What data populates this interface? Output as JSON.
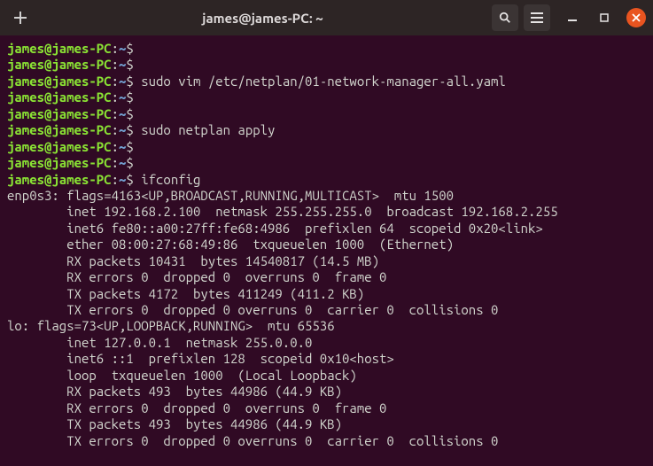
{
  "titlebar": {
    "title": "james@james-PC: ~"
  },
  "prompt": {
    "userhost": "james@james-PC",
    "colon": ":",
    "path": "~",
    "dollar": "$"
  },
  "lines": [
    {
      "type": "prompt",
      "cmd": ""
    },
    {
      "type": "prompt",
      "cmd": ""
    },
    {
      "type": "prompt",
      "cmd": "sudo vim /etc/netplan/01-network-manager-all.yaml"
    },
    {
      "type": "prompt",
      "cmd": ""
    },
    {
      "type": "prompt",
      "cmd": ""
    },
    {
      "type": "prompt",
      "cmd": "sudo netplan apply"
    },
    {
      "type": "prompt",
      "cmd": ""
    },
    {
      "type": "prompt",
      "cmd": ""
    },
    {
      "type": "prompt",
      "cmd": "ifconfig"
    },
    {
      "type": "out",
      "text": "enp0s3: flags=4163<UP,BROADCAST,RUNNING,MULTICAST>  mtu 1500"
    },
    {
      "type": "out",
      "text": "        inet 192.168.2.100  netmask 255.255.255.0  broadcast 192.168.2.255"
    },
    {
      "type": "out",
      "text": "        inet6 fe80::a00:27ff:fe68:4986  prefixlen 64  scopeid 0x20<link>"
    },
    {
      "type": "out",
      "text": "        ether 08:00:27:68:49:86  txqueuelen 1000  (Ethernet)"
    },
    {
      "type": "out",
      "text": "        RX packets 10431  bytes 14540817 (14.5 MB)"
    },
    {
      "type": "out",
      "text": "        RX errors 0  dropped 0  overruns 0  frame 0"
    },
    {
      "type": "out",
      "text": "        TX packets 4172  bytes 411249 (411.2 KB)"
    },
    {
      "type": "out",
      "text": "        TX errors 0  dropped 0 overruns 0  carrier 0  collisions 0"
    },
    {
      "type": "out",
      "text": ""
    },
    {
      "type": "out",
      "text": "lo: flags=73<UP,LOOPBACK,RUNNING>  mtu 65536"
    },
    {
      "type": "out",
      "text": "        inet 127.0.0.1  netmask 255.0.0.0"
    },
    {
      "type": "out",
      "text": "        inet6 ::1  prefixlen 128  scopeid 0x10<host>"
    },
    {
      "type": "out",
      "text": "        loop  txqueuelen 1000  (Local Loopback)"
    },
    {
      "type": "out",
      "text": "        RX packets 493  bytes 44986 (44.9 KB)"
    },
    {
      "type": "out",
      "text": "        RX errors 0  dropped 0  overruns 0  frame 0"
    },
    {
      "type": "out",
      "text": "        TX packets 493  bytes 44986 (44.9 KB)"
    },
    {
      "type": "out",
      "text": "        TX errors 0  dropped 0 overruns 0  carrier 0  collisions 0"
    }
  ]
}
